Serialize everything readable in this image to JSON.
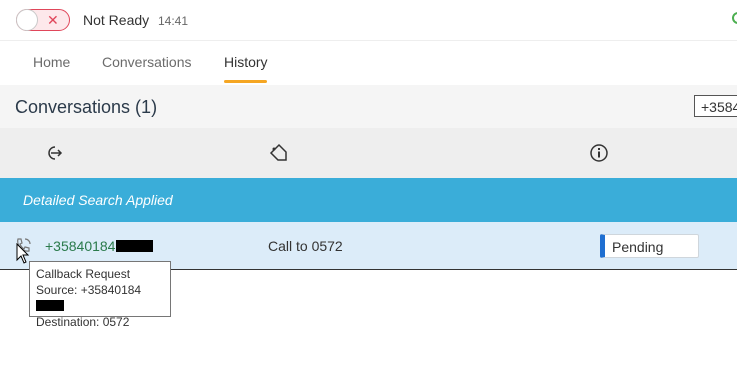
{
  "status": {
    "label": "Not Ready",
    "time": "14:41",
    "toggle_symbol": "✕",
    "color": "#e0465a"
  },
  "tabs": [
    {
      "label": "Home"
    },
    {
      "label": "Conversations"
    },
    {
      "label": "History",
      "active": true
    }
  ],
  "header": {
    "title": "Conversations (1)",
    "search_value": "+3584"
  },
  "columns": [
    {
      "icon": "direction-out-icon"
    },
    {
      "icon": "tag-icon"
    },
    {
      "icon": "info-icon"
    }
  ],
  "banner": {
    "text": "Detailed Search Applied",
    "color": "#3aadd9"
  },
  "rows": [
    {
      "icon": "callback-phone-icon",
      "number": "+35840184",
      "destination": "Call to 0572",
      "status": "Pending",
      "status_color": "#1f6fd1"
    }
  ],
  "tooltip": {
    "line1": "Callback Request",
    "line2": "Source: +35840184",
    "line3": "Destination: 0572"
  },
  "accent": "#f5a623"
}
